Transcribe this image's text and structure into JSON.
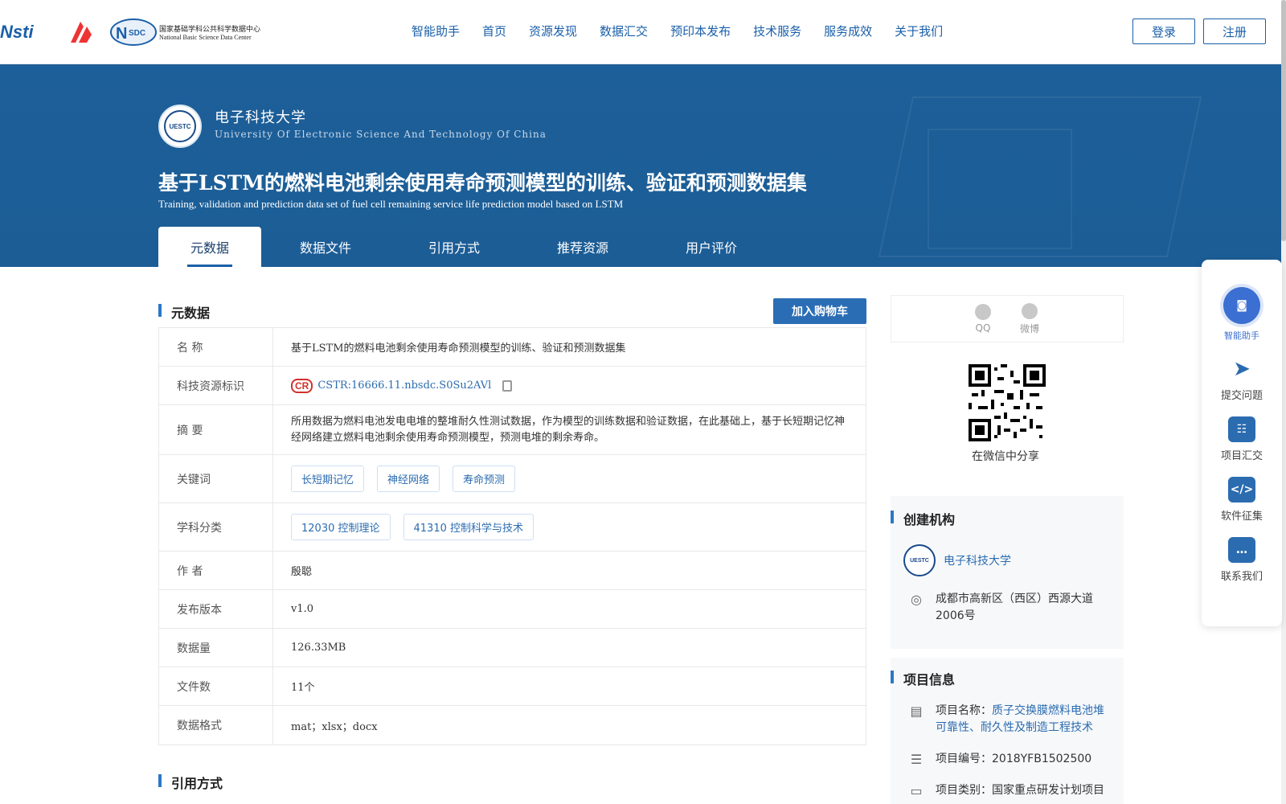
{
  "header": {
    "logos": {
      "nsti": "Nsti",
      "nsdc_cn": "国家基础学科公共科学数据中心",
      "nsdc_en": "National Basic Science Data Center"
    },
    "nav": [
      "智能助手",
      "首页",
      "资源发现",
      "数据汇交",
      "预印本发布",
      "技术服务",
      "服务成效",
      "关于我们"
    ],
    "login": "登录",
    "register": "注册"
  },
  "hero": {
    "univ_cn": "电子科技大学",
    "univ_en": "University Of Electronic Science And Technology Of China",
    "title_cn": "基于LSTM的燃料电池剩余使用寿命预测模型的训练、验证和预测数据集",
    "title_en": "Training, validation and prediction data set of fuel cell remaining service life prediction model based on LSTM",
    "tabs": [
      "元数据",
      "数据文件",
      "引用方式",
      "推荐资源",
      "用户评价"
    ],
    "active_tab": "元数据"
  },
  "metadata": {
    "section_title": "元数据",
    "cart_button": "加入购物车",
    "rows": [
      {
        "key": "名 称",
        "value": "基于LSTM的燃料电池剩余使用寿命预测模型的训练、验证和预测数据集"
      },
      {
        "key": "科技资源标识",
        "value": "CSTR:16666.11.nbsdc.S0Su2AVl"
      },
      {
        "key": "摘 要",
        "value": "所用数据为燃料电池发电电堆的整堆耐久性测试数据，作为模型的训练数据和验证数据，在此基础上，基于长短期记忆神经网络建立燃料电池剩余使用寿命预测模型，预测电堆的剩余寿命。"
      },
      {
        "key": "关键词",
        "tags": [
          "长短期记忆",
          "神经网络",
          "寿命预测"
        ]
      },
      {
        "key": "学科分类",
        "tags": [
          "12030 控制理论",
          "41310 控制科学与技术"
        ]
      },
      {
        "key": "作 者",
        "value": "殷聪"
      },
      {
        "key": "发布版本",
        "value": "v1.0"
      },
      {
        "key": "数据量",
        "value": "126.33MB"
      },
      {
        "key": "文件数",
        "value": "11个"
      },
      {
        "key": "数据格式",
        "value": "mat；xlsx；docx"
      }
    ]
  },
  "citation": {
    "section_title": "引用方式"
  },
  "share": {
    "qq": "QQ",
    "weibo": "微博",
    "wechat": "在微信中分享"
  },
  "org": {
    "section_title": "创建机构",
    "name": "电子科技大学",
    "address": "成都市高新区（西区）西源大道2006号"
  },
  "project": {
    "section_title": "项目信息",
    "name_label": "项目名称：",
    "name": "质子交换膜燃料电池堆可靠性、耐久性及制造工程技术",
    "number_label": "项目编号：",
    "number": "2018YFB1502500",
    "type_label": "项目类别：",
    "type": "国家重点研发计划项目"
  },
  "float_menu": [
    "智能助手",
    "提交问题",
    "项目汇交",
    "软件征集",
    "联系我们"
  ],
  "colors": {
    "brand": "#1d5f98",
    "link": "#2b6cb0",
    "accent": "#2a6db5"
  }
}
